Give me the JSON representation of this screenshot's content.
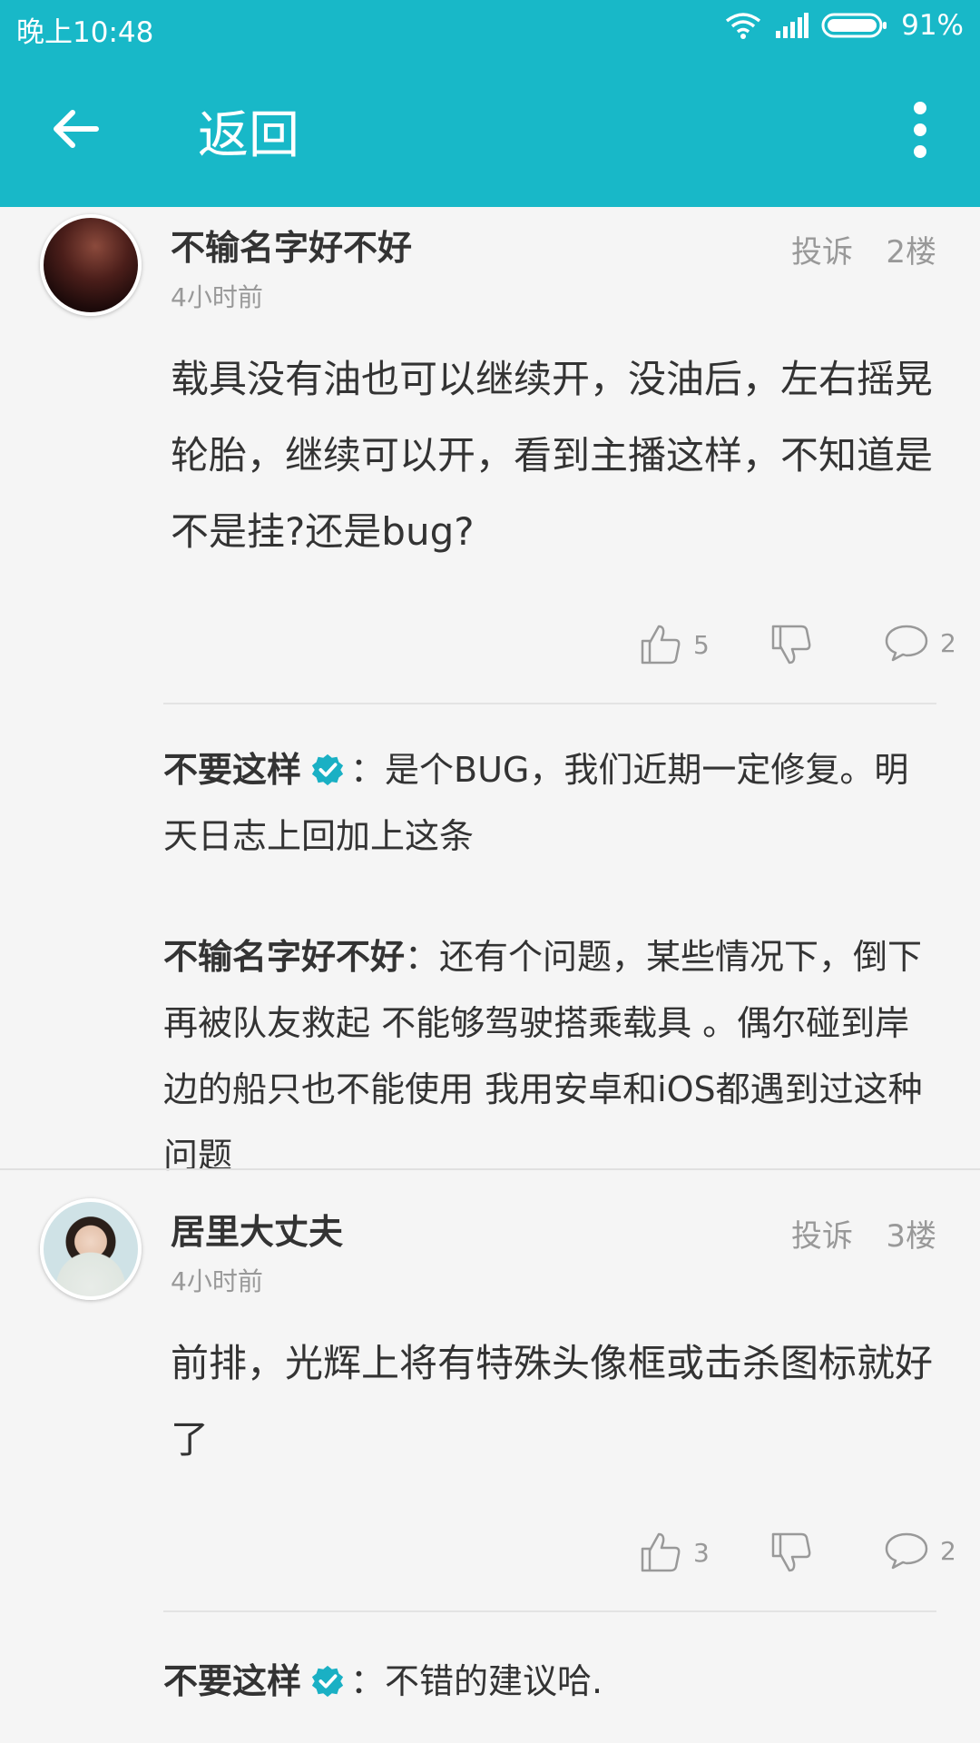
{
  "status_bar": {
    "time": "晚上10:48",
    "battery": "91%"
  },
  "header": {
    "title": "返回"
  },
  "posts": [
    {
      "username": "不输名字好不好",
      "time": "4小时前",
      "report": "投诉",
      "floor": "2楼",
      "content": "载具没有油也可以继续开，没油后，左右摇晃轮胎，继续可以开，看到主播这样，不知道是不是挂?还是bug?",
      "likes": "5",
      "comments": "2",
      "replies": [
        {
          "author": "不要这样",
          "verified": true,
          "text": "：是个BUG，我们近期一定修复。明天日志上回加上这条"
        },
        {
          "author": "不输名字好不好",
          "verified": false,
          "text": "：还有个问题，某些情况下，倒下再被队友救起 不能够驾驶搭乘载具 。偶尔碰到岸边的船只也不能使用 我用安卓和iOS都遇到过这种问题"
        }
      ]
    },
    {
      "username": "居里大丈夫",
      "time": "4小时前",
      "report": "投诉",
      "floor": "3楼",
      "content": "前排，光辉上将有特殊头像框或击杀图标就好了",
      "likes": "3",
      "comments": "2",
      "replies": [
        {
          "author": "不要这样",
          "verified": true,
          "text": "：不错的建议哈."
        }
      ]
    }
  ],
  "colors": {
    "accent": "#18b8c8",
    "verified": "#1ab0c4"
  }
}
